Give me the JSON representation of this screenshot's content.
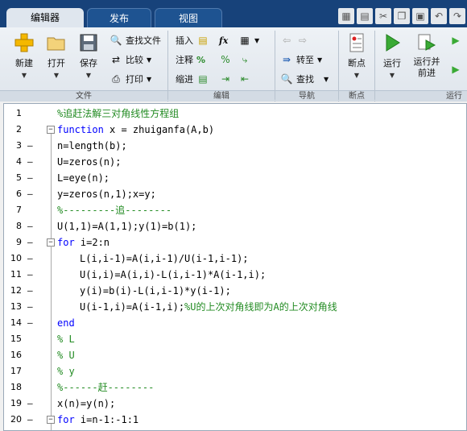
{
  "tabs": [
    {
      "label": "编辑器",
      "active": true
    },
    {
      "label": "发布",
      "active": false
    },
    {
      "label": "视图",
      "active": false
    }
  ],
  "ribbon": {
    "file": {
      "section_label": "文件",
      "new_label": "新建",
      "open_label": "打开",
      "save_label": "保存",
      "find_files_label": "查找文件",
      "compare_label": "比较",
      "print_label": "打印"
    },
    "edit": {
      "section_label": "编辑",
      "insert_label": "插入",
      "comment_label": "注释",
      "indent_label": "缩进",
      "fx_label": "fx",
      "percent_label": "%"
    },
    "navigate": {
      "section_label": "导航",
      "goto_label": "转至",
      "find_label": "查找"
    },
    "breakpoints": {
      "section_label": "断点",
      "breakpoints_label": "断点"
    },
    "run": {
      "section_label": "运行",
      "run_label": "运行",
      "run_advance_label": "运行并\n前进"
    }
  },
  "editor": {
    "lines": [
      {
        "n": "1",
        "dash": "",
        "fold": "",
        "indent": 1,
        "segs": [
          {
            "t": "%追赶法解三对角线性方程组",
            "c": "cm"
          }
        ]
      },
      {
        "n": "2",
        "dash": "",
        "fold": "−",
        "indent": 1,
        "segs": [
          {
            "t": "function",
            "c": "kw"
          },
          {
            "t": " x = zhuiganfa(A,b)",
            "c": "tx"
          }
        ]
      },
      {
        "n": "3",
        "dash": "—",
        "fold": "",
        "indent": 1,
        "segs": [
          {
            "t": "n=length(b);",
            "c": "tx"
          }
        ]
      },
      {
        "n": "4",
        "dash": "—",
        "fold": "",
        "indent": 1,
        "segs": [
          {
            "t": "U=zeros(n);",
            "c": "tx"
          }
        ]
      },
      {
        "n": "5",
        "dash": "—",
        "fold": "",
        "indent": 1,
        "segs": [
          {
            "t": "L=eye(n);",
            "c": "tx"
          }
        ]
      },
      {
        "n": "6",
        "dash": "—",
        "fold": "",
        "indent": 1,
        "segs": [
          {
            "t": "y=zeros(n,1);x=y;",
            "c": "tx"
          }
        ]
      },
      {
        "n": "7",
        "dash": "",
        "fold": "",
        "indent": 1,
        "segs": [
          {
            "t": "%---------追--------",
            "c": "cm"
          }
        ]
      },
      {
        "n": "8",
        "dash": "—",
        "fold": "",
        "indent": 1,
        "segs": [
          {
            "t": "U(1,1)=A(1,1);y(1)=b(1);",
            "c": "tx"
          }
        ]
      },
      {
        "n": "9",
        "dash": "—",
        "fold": "−",
        "indent": 1,
        "segs": [
          {
            "t": "for",
            "c": "kw"
          },
          {
            "t": " i=2:n",
            "c": "tx"
          }
        ]
      },
      {
        "n": "10",
        "dash": "—",
        "fold": "",
        "indent": 2,
        "segs": [
          {
            "t": "L(i,i-1)=A(i,i-1)/U(i-1,i-1);",
            "c": "tx"
          }
        ]
      },
      {
        "n": "11",
        "dash": "—",
        "fold": "",
        "indent": 2,
        "segs": [
          {
            "t": "U(i,i)=A(i,i)-L(i,i-1)*A(i-1,i);",
            "c": "tx"
          }
        ]
      },
      {
        "n": "12",
        "dash": "—",
        "fold": "",
        "indent": 2,
        "segs": [
          {
            "t": "y(i)=b(i)-L(i,i-1)*y(i-1);",
            "c": "tx"
          }
        ]
      },
      {
        "n": "13",
        "dash": "—",
        "fold": "",
        "indent": 2,
        "segs": [
          {
            "t": "U(i-1,i)=A(i-1,i);",
            "c": "tx"
          },
          {
            "t": "%U的上次对角线即为A的上次对角线",
            "c": "cm"
          }
        ]
      },
      {
        "n": "14",
        "dash": "—",
        "fold": "",
        "indent": 1,
        "segs": [
          {
            "t": "end",
            "c": "kw"
          }
        ]
      },
      {
        "n": "15",
        "dash": "",
        "fold": "",
        "indent": 1,
        "segs": [
          {
            "t": "% L",
            "c": "cm"
          }
        ]
      },
      {
        "n": "16",
        "dash": "",
        "fold": "",
        "indent": 1,
        "segs": [
          {
            "t": "% U",
            "c": "cm"
          }
        ]
      },
      {
        "n": "17",
        "dash": "",
        "fold": "",
        "indent": 1,
        "segs": [
          {
            "t": "% y",
            "c": "cm"
          }
        ]
      },
      {
        "n": "18",
        "dash": "",
        "fold": "",
        "indent": 1,
        "segs": [
          {
            "t": "%------赶--------",
            "c": "cm"
          }
        ]
      },
      {
        "n": "19",
        "dash": "—",
        "fold": "",
        "indent": 1,
        "segs": [
          {
            "t": "x(n)=y(n);",
            "c": "tx"
          }
        ]
      },
      {
        "n": "20",
        "dash": "—",
        "fold": "−",
        "indent": 1,
        "segs": [
          {
            "t": "for",
            "c": "kw"
          },
          {
            "t": " i=n-1:-1:1",
            "c": "tx"
          }
        ]
      }
    ]
  }
}
